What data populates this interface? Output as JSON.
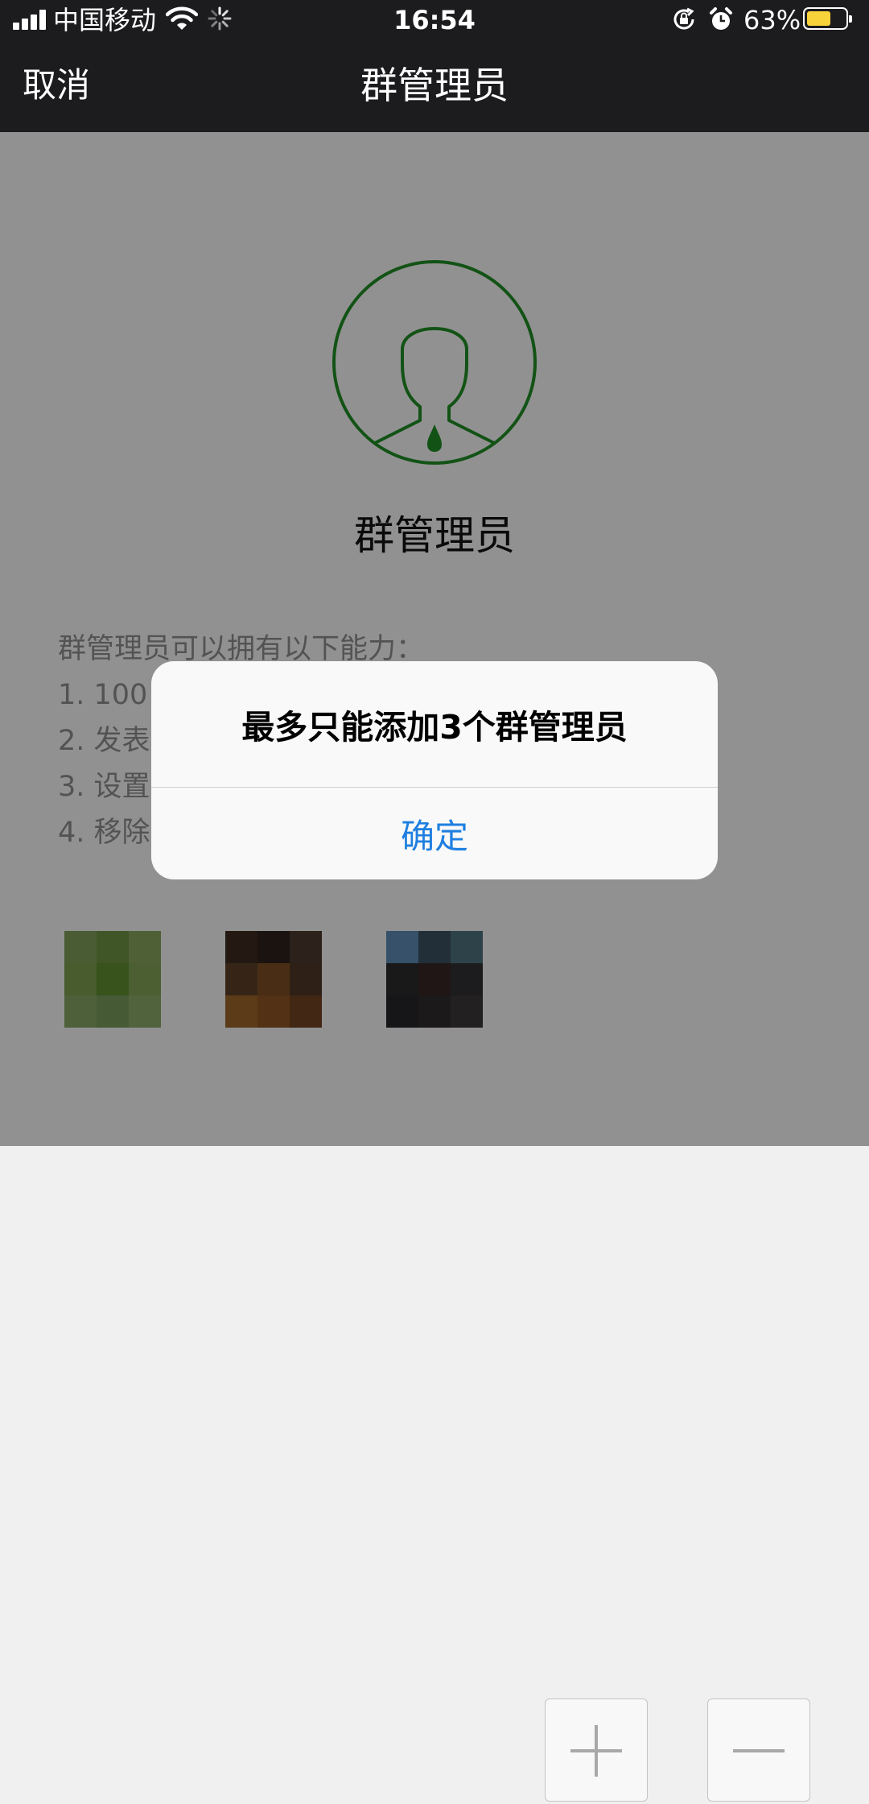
{
  "status_bar": {
    "carrier": "中国移动",
    "time": "16:54",
    "battery_percent": "63%",
    "battery_level": 0.63,
    "battery_color": "#f8d33a",
    "icons": [
      "signal-icon",
      "wifi-icon",
      "activity-spinner-icon",
      "orientation-lock-icon",
      "alarm-icon",
      "battery-icon"
    ]
  },
  "nav": {
    "cancel_label": "取消",
    "title": "群管理员"
  },
  "main": {
    "hero_icon": "admin-person-icon",
    "accent_color": "#1f8a24",
    "heading": "群管理员",
    "description_title": "群管理员可以拥有以下能力：",
    "abilities": [
      "1. 100",
      "2. 发表",
      "3. 设置",
      "4. 移除"
    ],
    "member_avatars_count": 3,
    "add_icon": "plus-icon",
    "remove_icon": "minus-icon"
  },
  "alert": {
    "message": "最多只能添加3个群管理员",
    "confirm_label": "确定",
    "confirm_color": "#1f7fe0"
  }
}
